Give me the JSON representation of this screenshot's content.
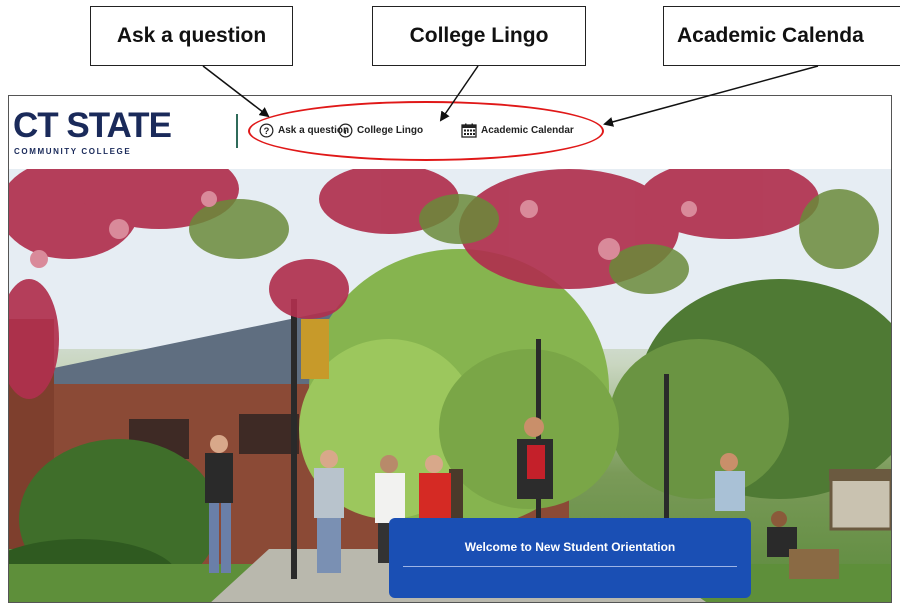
{
  "callouts": {
    "ask": "Ask a question",
    "lingo": "College Lingo",
    "calendar": "Academic Calenda"
  },
  "logo": {
    "main": "CT STATE",
    "sub": "COMMUNITY COLLEGE"
  },
  "nav": {
    "ask": {
      "label": "Ask a question",
      "icon": "question-circle-icon"
    },
    "lingo": {
      "label": "College Lingo",
      "icon": "info-circle-icon"
    },
    "calendar": {
      "label": "Academic Calendar",
      "icon": "calendar-icon"
    }
  },
  "banner": {
    "title": "Welcome to New Student Orientation"
  },
  "colors": {
    "brand_navy": "#1a2a5a",
    "annotation_red": "#e01818",
    "banner_blue": "#1a4fb4",
    "divider_green": "#2f6b5a"
  }
}
